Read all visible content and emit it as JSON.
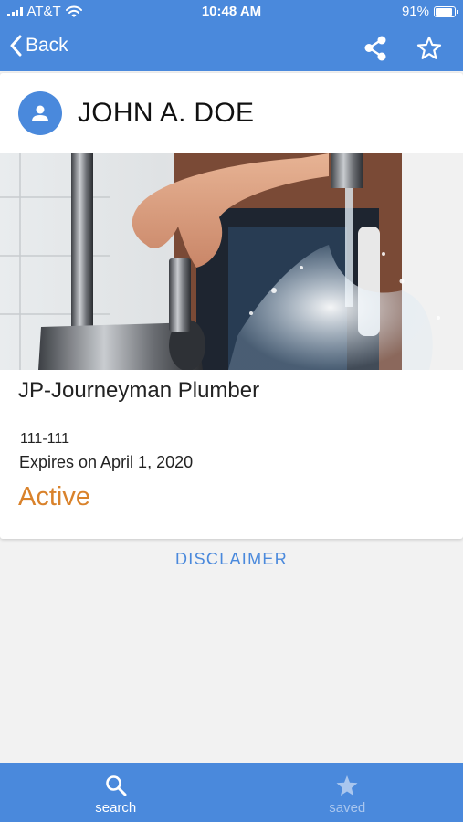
{
  "status_bar": {
    "carrier": "AT&T",
    "time": "10:48 AM",
    "battery": "91%",
    "battery_level": 0.91
  },
  "nav": {
    "back_label": "Back",
    "share_icon": "share-icon",
    "favorite_icon": "star-outline-icon"
  },
  "person": {
    "name": "JOHN A. DOE",
    "avatar_icon": "person-icon"
  },
  "license": {
    "title": "JP-Journeyman Plumber",
    "number": "111-111",
    "expiry": "Expires on April 1, 2020",
    "status": "Active"
  },
  "disclaimer_label": "DISCLAIMER",
  "tabs": [
    {
      "label": "search",
      "icon": "search-icon",
      "active": true
    },
    {
      "label": "saved",
      "icon": "star-icon",
      "active": false
    }
  ],
  "colors": {
    "primary": "#4a89dc",
    "status_active": "#d9822b",
    "tab_active": "#ffffff",
    "tab_inactive": "#a9c6ee"
  }
}
